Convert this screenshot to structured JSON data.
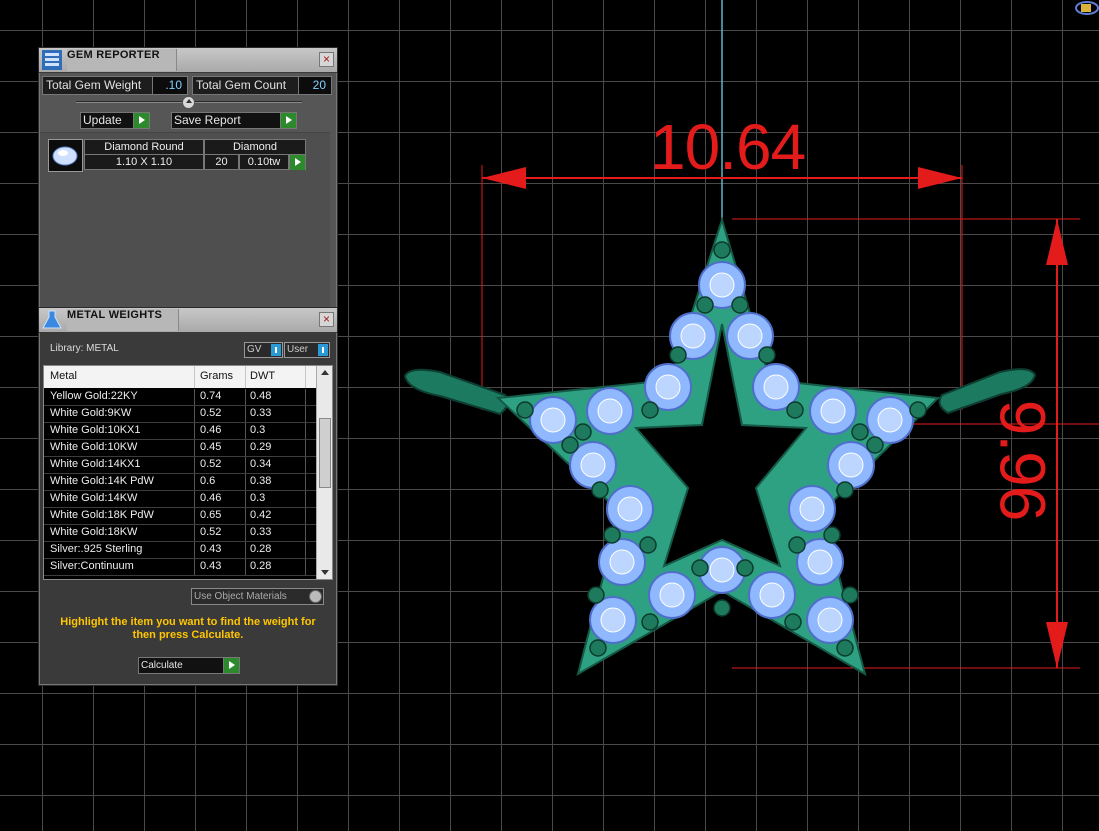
{
  "colors": {
    "dimension_red": "#e41b1b",
    "gem_blue": "#8fb8ff",
    "setting_green": "#2a9a78",
    "hint_yellow": "#ffc600"
  },
  "viewport": {
    "dim_horizontal": "10.64",
    "dim_vertical": "9.96"
  },
  "gem_reporter": {
    "title": "GEM REPORTER",
    "close_icon": "close-icon",
    "total_weight_label": "Total Gem Weight",
    "total_weight_value": ".10",
    "total_count_label": "Total Gem Count",
    "total_count_value": "20",
    "update_label": "Update",
    "save_label": "Save Report",
    "gem": {
      "shape": "Diamond Round",
      "size": "1.10 X 1.10",
      "material": "Diamond",
      "count": "20",
      "weight": "0.10tw"
    }
  },
  "metal_weights": {
    "title": "METAL WEIGHTS",
    "library_label": "Library: METAL",
    "gv_label": "GV",
    "user_label": "User",
    "columns": [
      "Metal",
      "Grams",
      "DWT"
    ],
    "rows": [
      [
        "Yellow Gold:22KY",
        "0.74",
        "0.48"
      ],
      [
        "White Gold:9KW",
        "0.52",
        "0.33"
      ],
      [
        "White Gold:10KX1",
        "0.46",
        "0.3"
      ],
      [
        "White Gold:10KW",
        "0.45",
        "0.29"
      ],
      [
        "White Gold:14KX1",
        "0.52",
        "0.34"
      ],
      [
        "White Gold:14K PdW",
        "0.6",
        "0.38"
      ],
      [
        "White Gold:14KW",
        "0.46",
        "0.3"
      ],
      [
        "White Gold:18K PdW",
        "0.65",
        "0.42"
      ],
      [
        "White Gold:18KW",
        "0.52",
        "0.33"
      ],
      [
        "Silver:.925 Sterling",
        "0.43",
        "0.28"
      ],
      [
        "Silver:Continuum",
        "0.43",
        "0.28"
      ]
    ],
    "use_object_materials": "Use Object Materials",
    "hint": "Highlight the item you want to find the weight for then press Calculate.",
    "calculate_label": "Calculate"
  }
}
